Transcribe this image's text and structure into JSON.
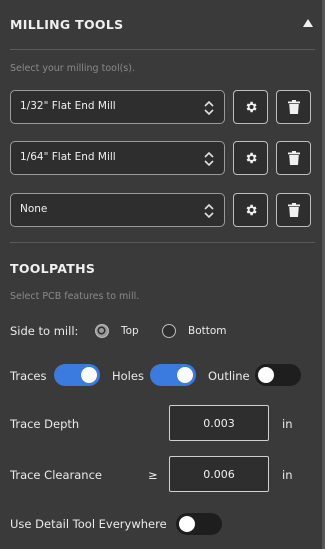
{
  "milling_tools": {
    "title": "MILLING TOOLS",
    "hint": "Select your milling tool(s).",
    "tools": [
      {
        "value": "1/32\" Flat End Mill"
      },
      {
        "value": "1/64\" Flat End Mill"
      },
      {
        "value": "None"
      }
    ]
  },
  "toolpaths": {
    "title": "TOOLPATHS",
    "hint": "Select PCB features to mill.",
    "side_label": "Side to mill:",
    "side_options": [
      "Top",
      "Bottom"
    ],
    "side_selected": "Top",
    "features": [
      {
        "label": "Traces",
        "on": true
      },
      {
        "label": "Holes",
        "on": true
      },
      {
        "label": "Outline",
        "on": false
      }
    ],
    "trace_depth": {
      "label": "Trace Depth",
      "value": "0.003",
      "unit": "in"
    },
    "trace_clearance": {
      "label": "Trace Clearance",
      "prefix": "≥",
      "value": "0.006",
      "unit": "in"
    },
    "detail_tool": {
      "label": "Use Detail Tool Everywhere",
      "on": false
    }
  },
  "colors": {
    "toggle_on": "#3b7be0",
    "panel_bg": "#3a3a3a"
  },
  "icons": [
    "collapse-arrow-icon",
    "updown-chevron-icon",
    "gear-icon",
    "trash-icon"
  ]
}
